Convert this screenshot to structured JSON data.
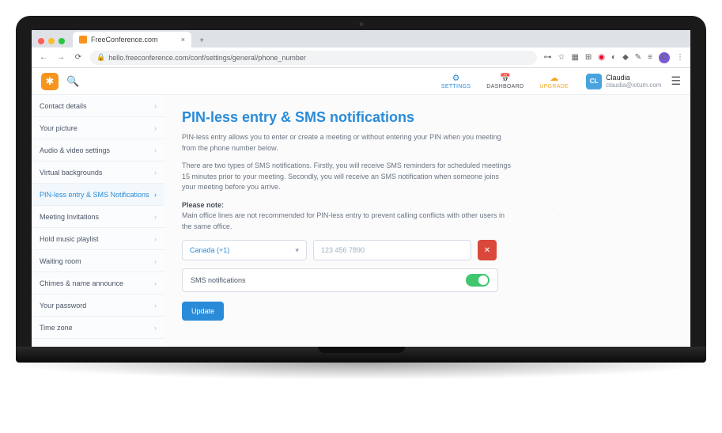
{
  "browser": {
    "tab": {
      "title": "FreeConference.com",
      "favicon_color": "#f7941e"
    },
    "url": "hello.freeconference.com/conf/settings/general/phone_number",
    "traffic": {
      "close": "#ff5f57",
      "min": "#febc2e",
      "max": "#28c840"
    }
  },
  "header": {
    "nav": {
      "settings": {
        "label": "SETTINGS",
        "color": "#2a8bd8"
      },
      "dashboard": {
        "label": "DASHBOARD",
        "color": "#4a5057"
      },
      "upgrade": {
        "label": "UPGRADE",
        "color": "#f5a623"
      }
    },
    "user": {
      "initials": "CL",
      "name": "Claudia",
      "email": "claudia@iotum.com"
    }
  },
  "sidebar": {
    "items": [
      {
        "label": "Contact details"
      },
      {
        "label": "Your picture"
      },
      {
        "label": "Audio & video settings"
      },
      {
        "label": "Virtual backgrounds"
      },
      {
        "label": "PIN-less entry & SMS Notifications",
        "active": true
      },
      {
        "label": "Meeting Invitations"
      },
      {
        "label": "Hold music playlist"
      },
      {
        "label": "Waiting room"
      },
      {
        "label": "Chimes & name announce"
      },
      {
        "label": "Your password"
      },
      {
        "label": "Time zone"
      }
    ]
  },
  "content": {
    "title": "PIN-less entry & SMS notifications",
    "p1": "PIN-less entry allows you to enter or create a meeting or without entering your PIN when you meeting from the phone number below.",
    "p2": "There are two types of SMS notifications. Firstly, you will receive SMS reminders for scheduled meetings 15 minutes prior to your meeting. Secondly, you will receive an SMS notification when someone joins your meeting before you arrive.",
    "note_label": "Please note:",
    "note_text": "Main office lines are not recommended for PIN-less entry to prevent calling conflicts with other users in the same office.",
    "country": {
      "value": "Canada (+1)"
    },
    "phone": {
      "placeholder": "123 456 7890"
    },
    "sms_label": "SMS notifications",
    "update": "Update"
  }
}
